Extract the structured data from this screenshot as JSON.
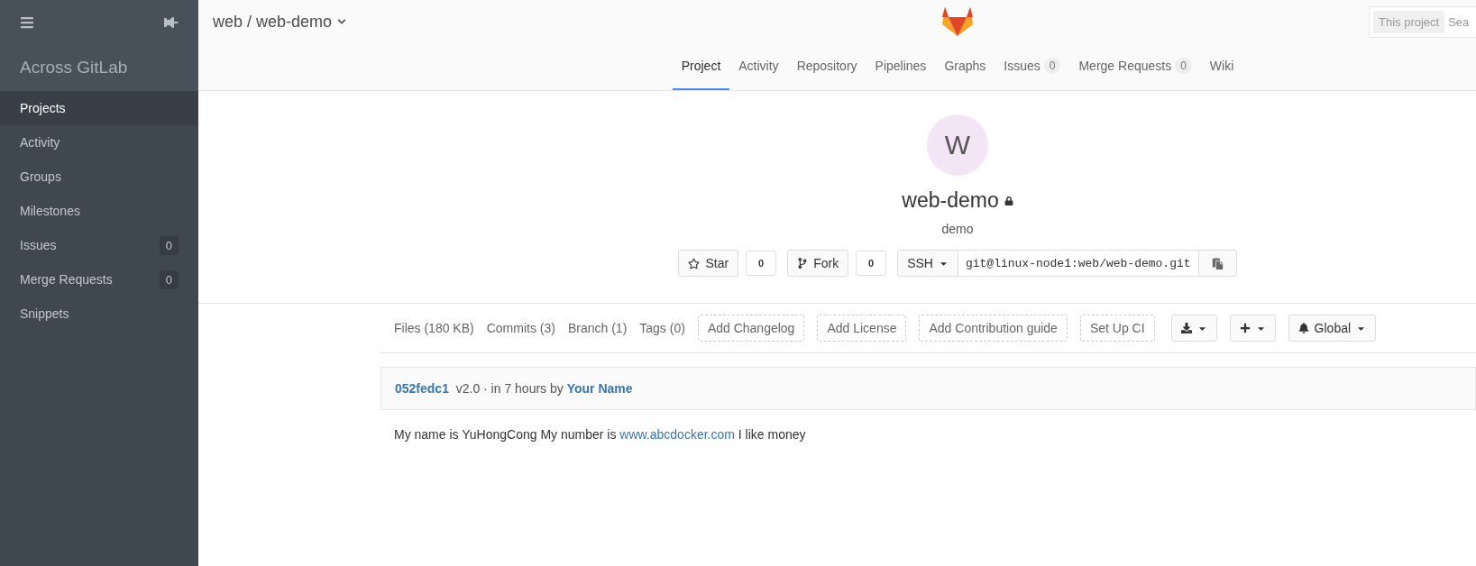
{
  "sidebar": {
    "brand": "Across GitLab",
    "items": [
      {
        "label": "Projects",
        "selected": true
      },
      {
        "label": "Activity",
        "selected": false
      },
      {
        "label": "Groups",
        "selected": false
      },
      {
        "label": "Milestones",
        "selected": false
      },
      {
        "label": "Issues",
        "count": "0",
        "selected": false
      },
      {
        "label": "Merge Requests",
        "count": "0",
        "selected": false
      },
      {
        "label": "Snippets",
        "selected": false
      }
    ]
  },
  "header": {
    "title": "web / web-demo",
    "search": {
      "scope": "This project",
      "placeholder": "Sea"
    }
  },
  "tabs": [
    {
      "label": "Project",
      "selected": true
    },
    {
      "label": "Activity",
      "selected": false
    },
    {
      "label": "Repository",
      "selected": false
    },
    {
      "label": "Pipelines",
      "selected": false
    },
    {
      "label": "Graphs",
      "selected": false
    },
    {
      "label": "Issues",
      "count": "0",
      "selected": false
    },
    {
      "label": "Merge Requests",
      "count": "0",
      "selected": false
    },
    {
      "label": "Wiki",
      "selected": false
    }
  ],
  "project": {
    "avatar_letter": "W",
    "name": "web-demo",
    "private": true,
    "description": "demo",
    "star": {
      "label": "Star",
      "count": "0"
    },
    "fork": {
      "label": "Fork",
      "count": "0"
    },
    "clone": {
      "protocol": "SSH",
      "url": "git@linux-node1:web/web-demo.git"
    }
  },
  "repo_stats": [
    {
      "kind": "stat",
      "label": "Files (180 KB)"
    },
    {
      "kind": "stat",
      "label": "Commits (3)"
    },
    {
      "kind": "stat",
      "label": "Branch (1)"
    },
    {
      "kind": "stat",
      "label": "Tags (0)"
    },
    {
      "kind": "add",
      "label": "Add Changelog"
    },
    {
      "kind": "add",
      "label": "Add License"
    },
    {
      "kind": "add",
      "label": "Add Contribution guide"
    },
    {
      "kind": "add",
      "label": "Set Up CI"
    }
  ],
  "actions": [
    {
      "kind": "download"
    },
    {
      "kind": "add"
    },
    {
      "kind": "notify",
      "label": "Global"
    }
  ],
  "commit": {
    "sha": "052fedc1",
    "message": "v2.0 · in 7 hours by",
    "author": "Your Name"
  },
  "readme": {
    "before": "My name is YuHongCong My number is",
    "link": "www.abcdocker.com",
    "after": "I like money"
  }
}
